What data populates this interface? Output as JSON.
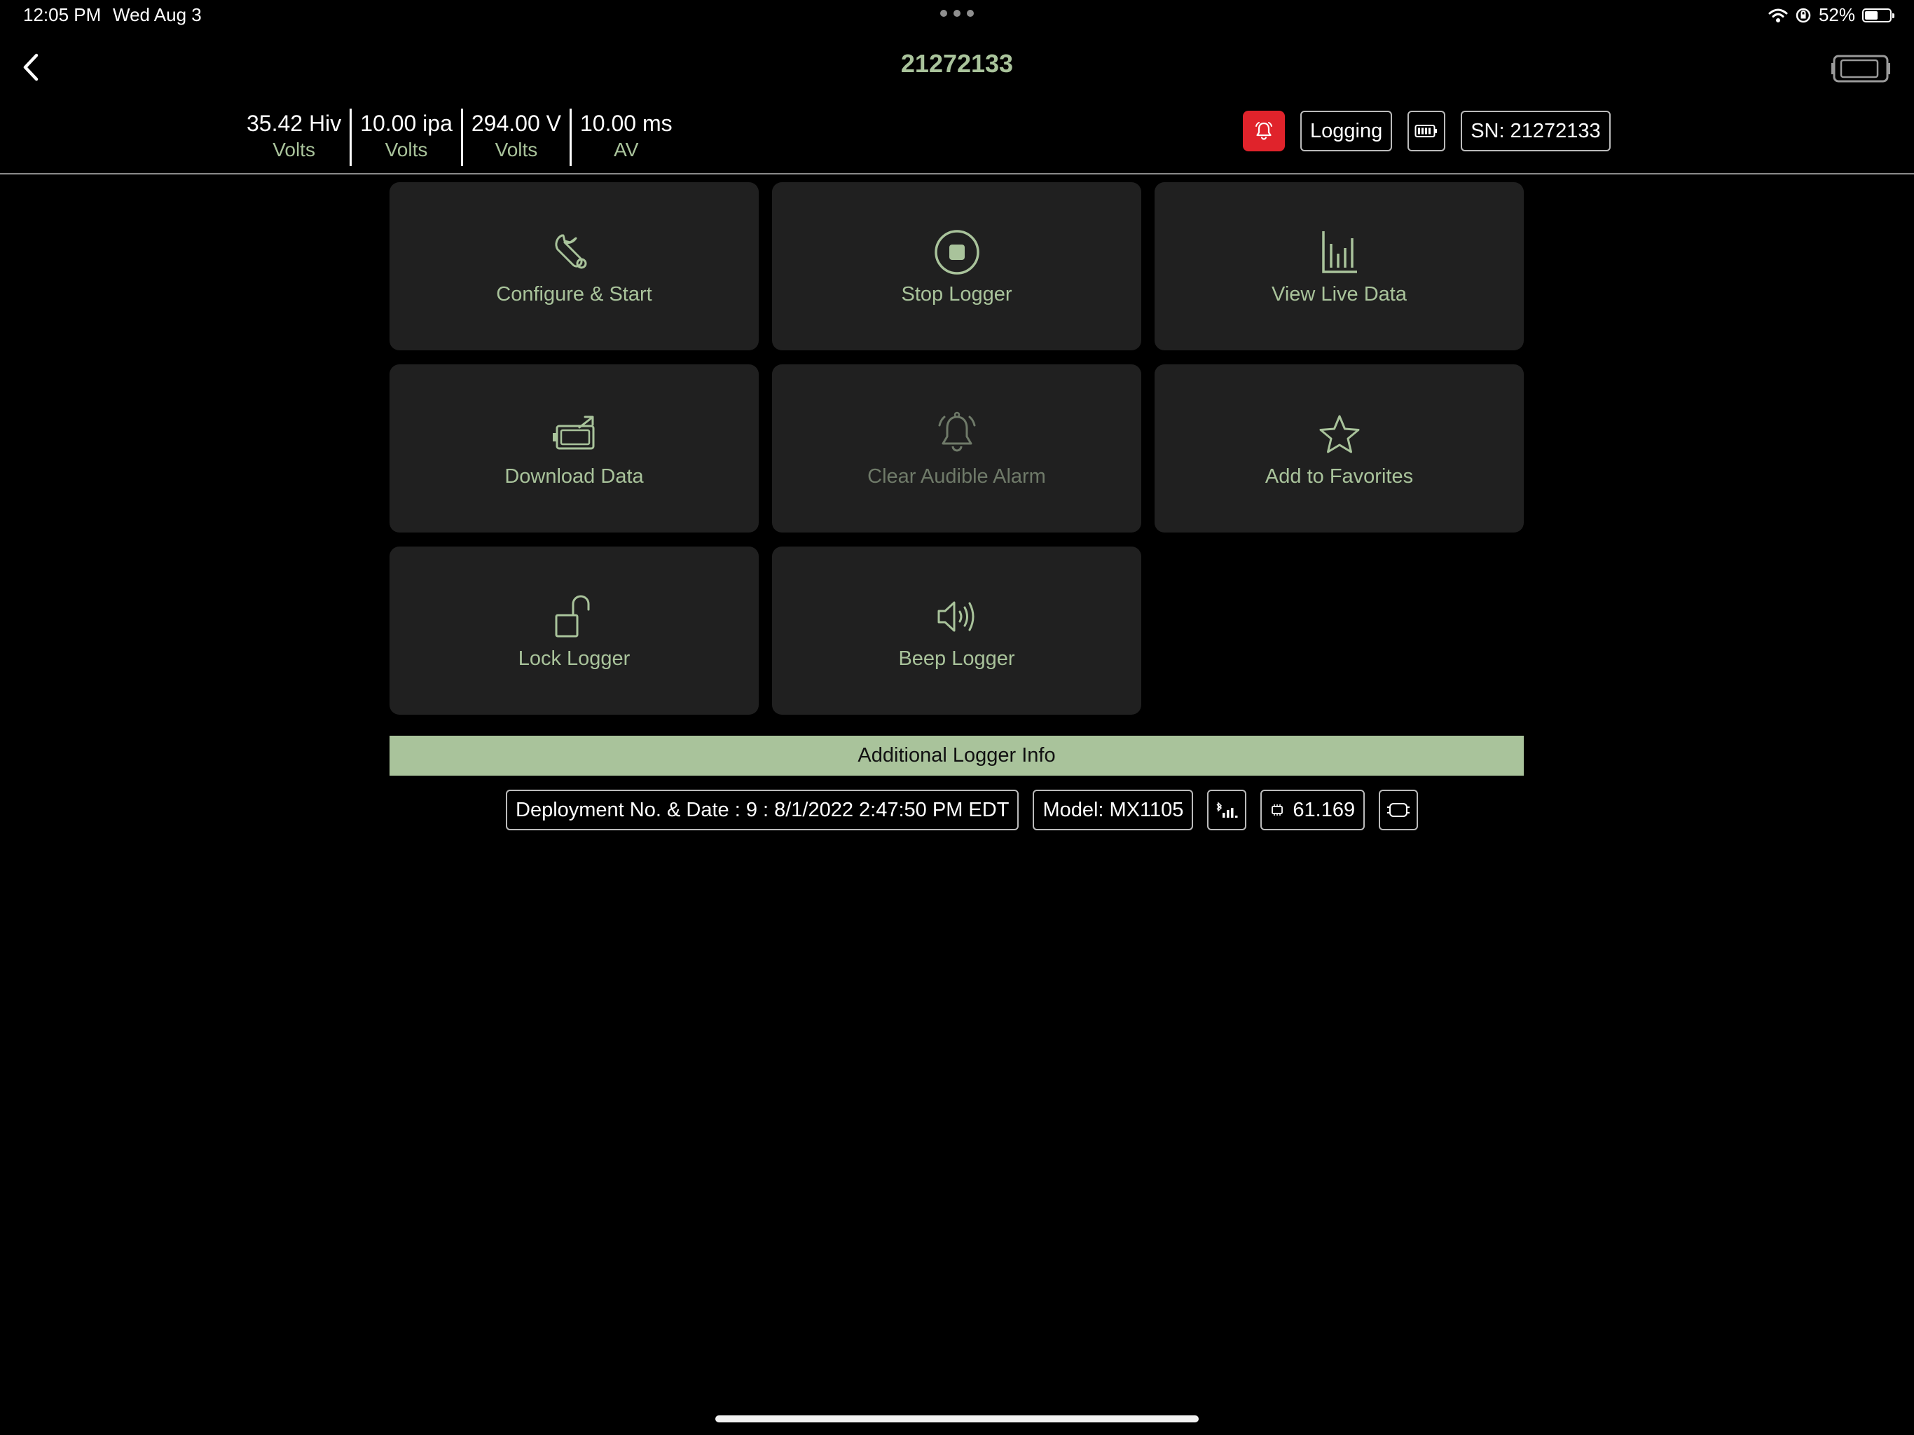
{
  "status_bar": {
    "time": "12:05 PM",
    "date": "Wed Aug 3",
    "battery_percent": "52%",
    "battery_level": 0.52
  },
  "header": {
    "title": "21272133"
  },
  "readings": [
    {
      "value": "35.42 Hiv",
      "unit": "Volts"
    },
    {
      "value": "10.00 ipa",
      "unit": "Volts"
    },
    {
      "value": "294.00 V",
      "unit": "Volts"
    },
    {
      "value": "10.00 ms",
      "unit": "AV"
    }
  ],
  "badges": {
    "status": "Logging",
    "serial": "SN: 21272133"
  },
  "actions": [
    {
      "label": "Configure & Start",
      "icon": "wrench-icon",
      "enabled": true
    },
    {
      "label": "Stop Logger",
      "icon": "stop-circle-icon",
      "enabled": true
    },
    {
      "label": "View Live Data",
      "icon": "bar-chart-icon",
      "enabled": true
    },
    {
      "label": "Download Data",
      "icon": "download-data-icon",
      "enabled": true
    },
    {
      "label": "Clear Audible Alarm",
      "icon": "bell-icon",
      "enabled": false
    },
    {
      "label": "Add to Favorites",
      "icon": "star-icon",
      "enabled": true
    },
    {
      "label": "Lock Logger",
      "icon": "unlock-icon",
      "enabled": true
    },
    {
      "label": "Beep Logger",
      "icon": "speaker-icon",
      "enabled": true
    }
  ],
  "additional_info": {
    "title": "Additional Logger Info",
    "deployment": "Deployment No. & Date : 9 : 8/1/2022 2:47:50 PM EDT",
    "model": "Model: MX1105",
    "firmware": "61.169"
  },
  "colors": {
    "accent": "#a9c39b",
    "tile_bg": "#202020",
    "alarm_red": "#e0232b",
    "background": "#000000"
  }
}
